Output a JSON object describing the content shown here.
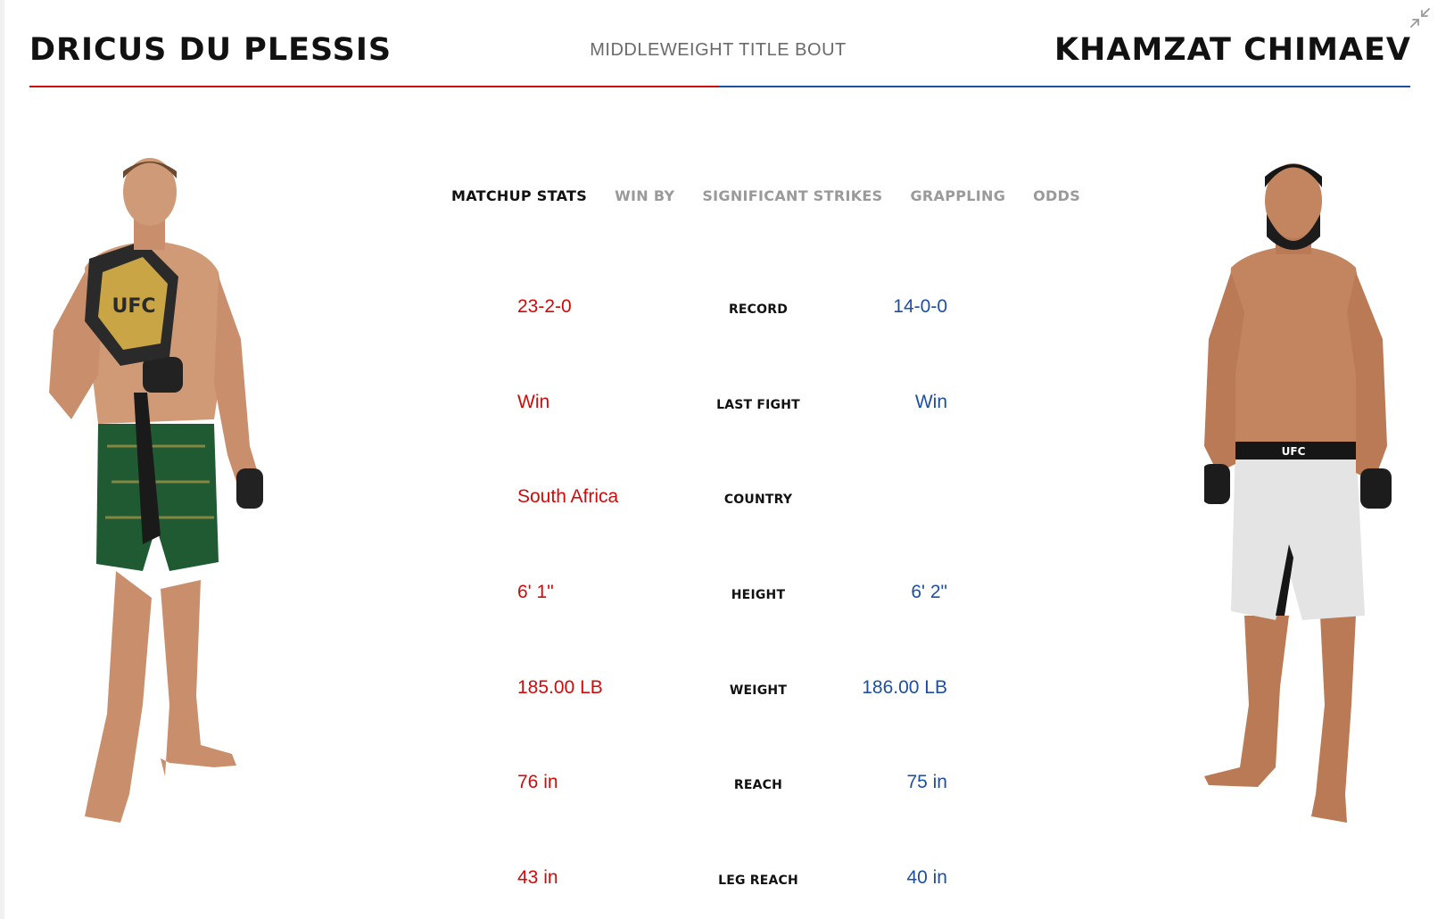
{
  "header": {
    "red_fighter": "DRICUS DU PLESSIS",
    "bout_title": "MIDDLEWEIGHT TITLE BOUT",
    "blue_fighter": "KHAMZAT CHIMAEV"
  },
  "colors": {
    "red_corner": "#d20a0a",
    "blue_corner": "#1e4fa3",
    "active_tab": "#111111",
    "inactive_tab": "#9a9a9a"
  },
  "icons": {
    "collapse": "collapse-arrows-icon"
  },
  "tabs": [
    {
      "label": "MATCHUP STATS",
      "active": true
    },
    {
      "label": "WIN BY",
      "active": false
    },
    {
      "label": "SIGNIFICANT STRIKES",
      "active": false
    },
    {
      "label": "GRAPPLING",
      "active": false
    },
    {
      "label": "ODDS",
      "active": false
    }
  ],
  "stats": [
    {
      "label": "RECORD",
      "red": "23-2-0",
      "blue": "14-0-0"
    },
    {
      "label": "LAST FIGHT",
      "red": "Win",
      "blue": "Win"
    },
    {
      "label": "COUNTRY",
      "red": "South Africa",
      "blue": ""
    },
    {
      "label": "HEIGHT",
      "red": "6' 1\"",
      "blue": "6' 2\""
    },
    {
      "label": "WEIGHT",
      "red": "185.00 LB",
      "blue": "186.00 LB"
    },
    {
      "label": "REACH",
      "red": "76 in",
      "blue": "75 in"
    },
    {
      "label": "LEG REACH",
      "red": "43 in",
      "blue": "40 in"
    }
  ]
}
